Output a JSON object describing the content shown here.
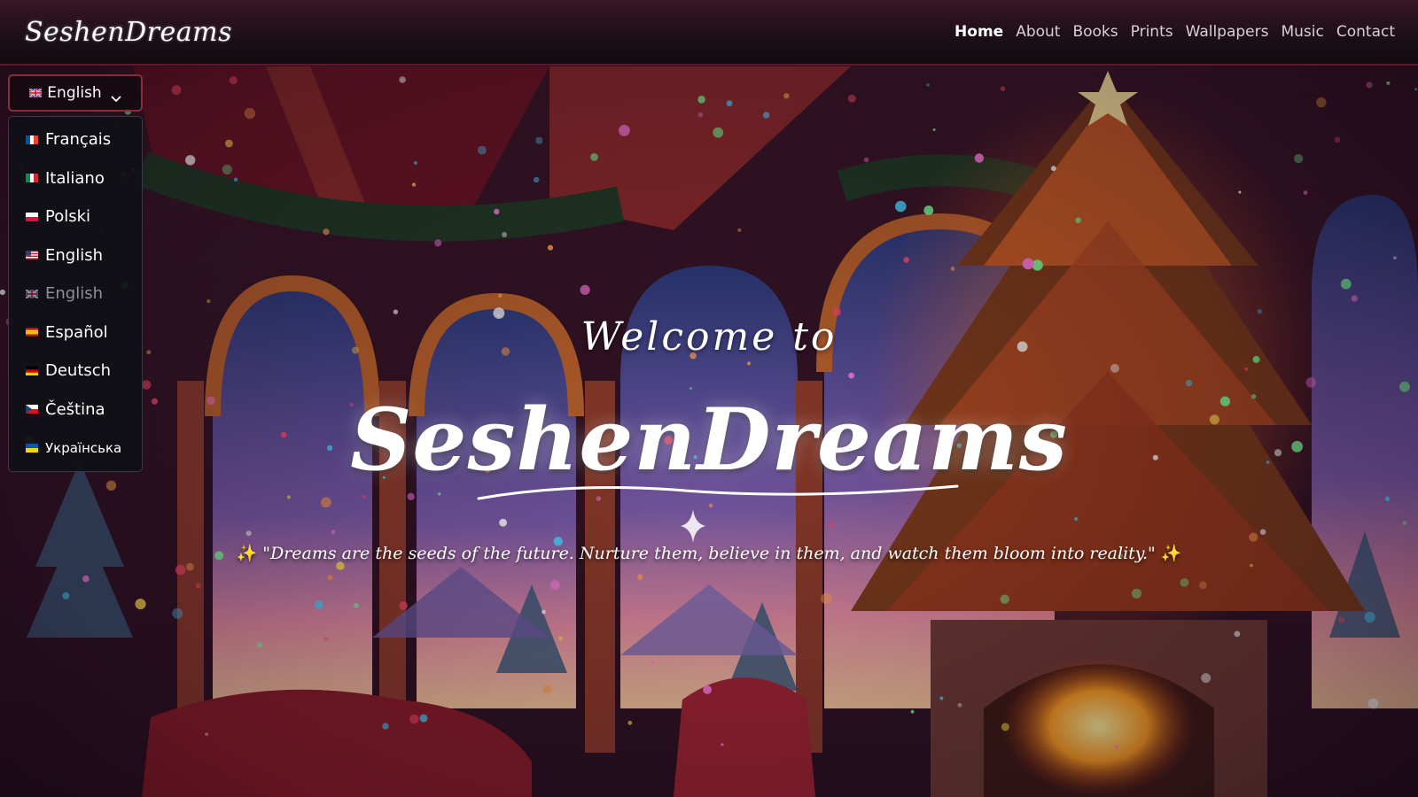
{
  "brand": {
    "name": "SeshenDreams"
  },
  "nav": {
    "items": [
      {
        "label": "Home",
        "active": true
      },
      {
        "label": "About",
        "active": false
      },
      {
        "label": "Books",
        "active": false
      },
      {
        "label": "Prints",
        "active": false
      },
      {
        "label": "Wallpapers",
        "active": false
      },
      {
        "label": "Music",
        "active": false
      },
      {
        "label": "Contact",
        "active": false
      }
    ]
  },
  "language_selector": {
    "selected_label": "English",
    "selected_flag": "uk-flag-icon",
    "options": [
      {
        "label": "Français",
        "flag": "france-flag-icon"
      },
      {
        "label": "Italiano",
        "flag": "italy-flag-icon"
      },
      {
        "label": "Polski",
        "flag": "poland-flag-icon"
      },
      {
        "label": "English",
        "flag": "usa-flag-icon"
      },
      {
        "label": "English",
        "flag": "uk-flag-icon",
        "current": true
      },
      {
        "label": "Español",
        "flag": "spain-flag-icon"
      },
      {
        "label": "Deutsch",
        "flag": "germany-flag-icon"
      },
      {
        "label": "Čeština",
        "flag": "czech-flag-icon"
      },
      {
        "label": "Українська",
        "flag": "ukraine-flag-icon"
      }
    ]
  },
  "hero": {
    "welcome": "Welcome to",
    "title": "SeshenDreams",
    "quote": "\"Dreams are the seeds of the future. Nurture them, believe in them, and watch them bloom into reality.\"",
    "quote_lead_icon": "sparkles-icon",
    "quote_trail_icon": "sparkles-icon",
    "spark_glyph": "✨"
  },
  "colors": {
    "nav_bg": "#1d0f18",
    "accent_border": "#8a2c3c",
    "menu_bg": "#0e1016",
    "muted_text": "#8f8f96"
  }
}
